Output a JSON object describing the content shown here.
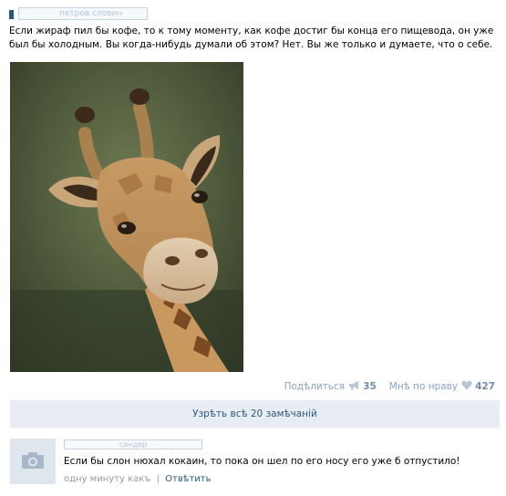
{
  "post": {
    "author_name": "петров словин",
    "text": "Если жираф пил бы кофе, то к тому моменту, как кофе достиг бы конца его пищевода, он уже был бы холодным. Вы когда-нибудь думали об этом? Нет. Вы же только и думаете, что о себе."
  },
  "actions": {
    "share_label": "Подѣлиться",
    "share_count": "35",
    "like_label": "Мнѣ по нраву",
    "like_count": "427"
  },
  "comments_bar": {
    "label": "Узрѣть всѣ 20 замѣчаній"
  },
  "comment": {
    "author_name": "синдер",
    "text": "Если бы слон нюхал кокаин, то пока он шел по его носу его уже б отпустило!",
    "time": "одну минуту какъ",
    "reply_label": "Отвѣтить"
  },
  "icons": {
    "share": "megaphone-icon",
    "like": "heart-icon",
    "avatar_placeholder": "camera-icon"
  },
  "colors": {
    "link": "#2b587a",
    "muted_link": "#8ba2bb",
    "bar_bg": "#e8edf3"
  }
}
